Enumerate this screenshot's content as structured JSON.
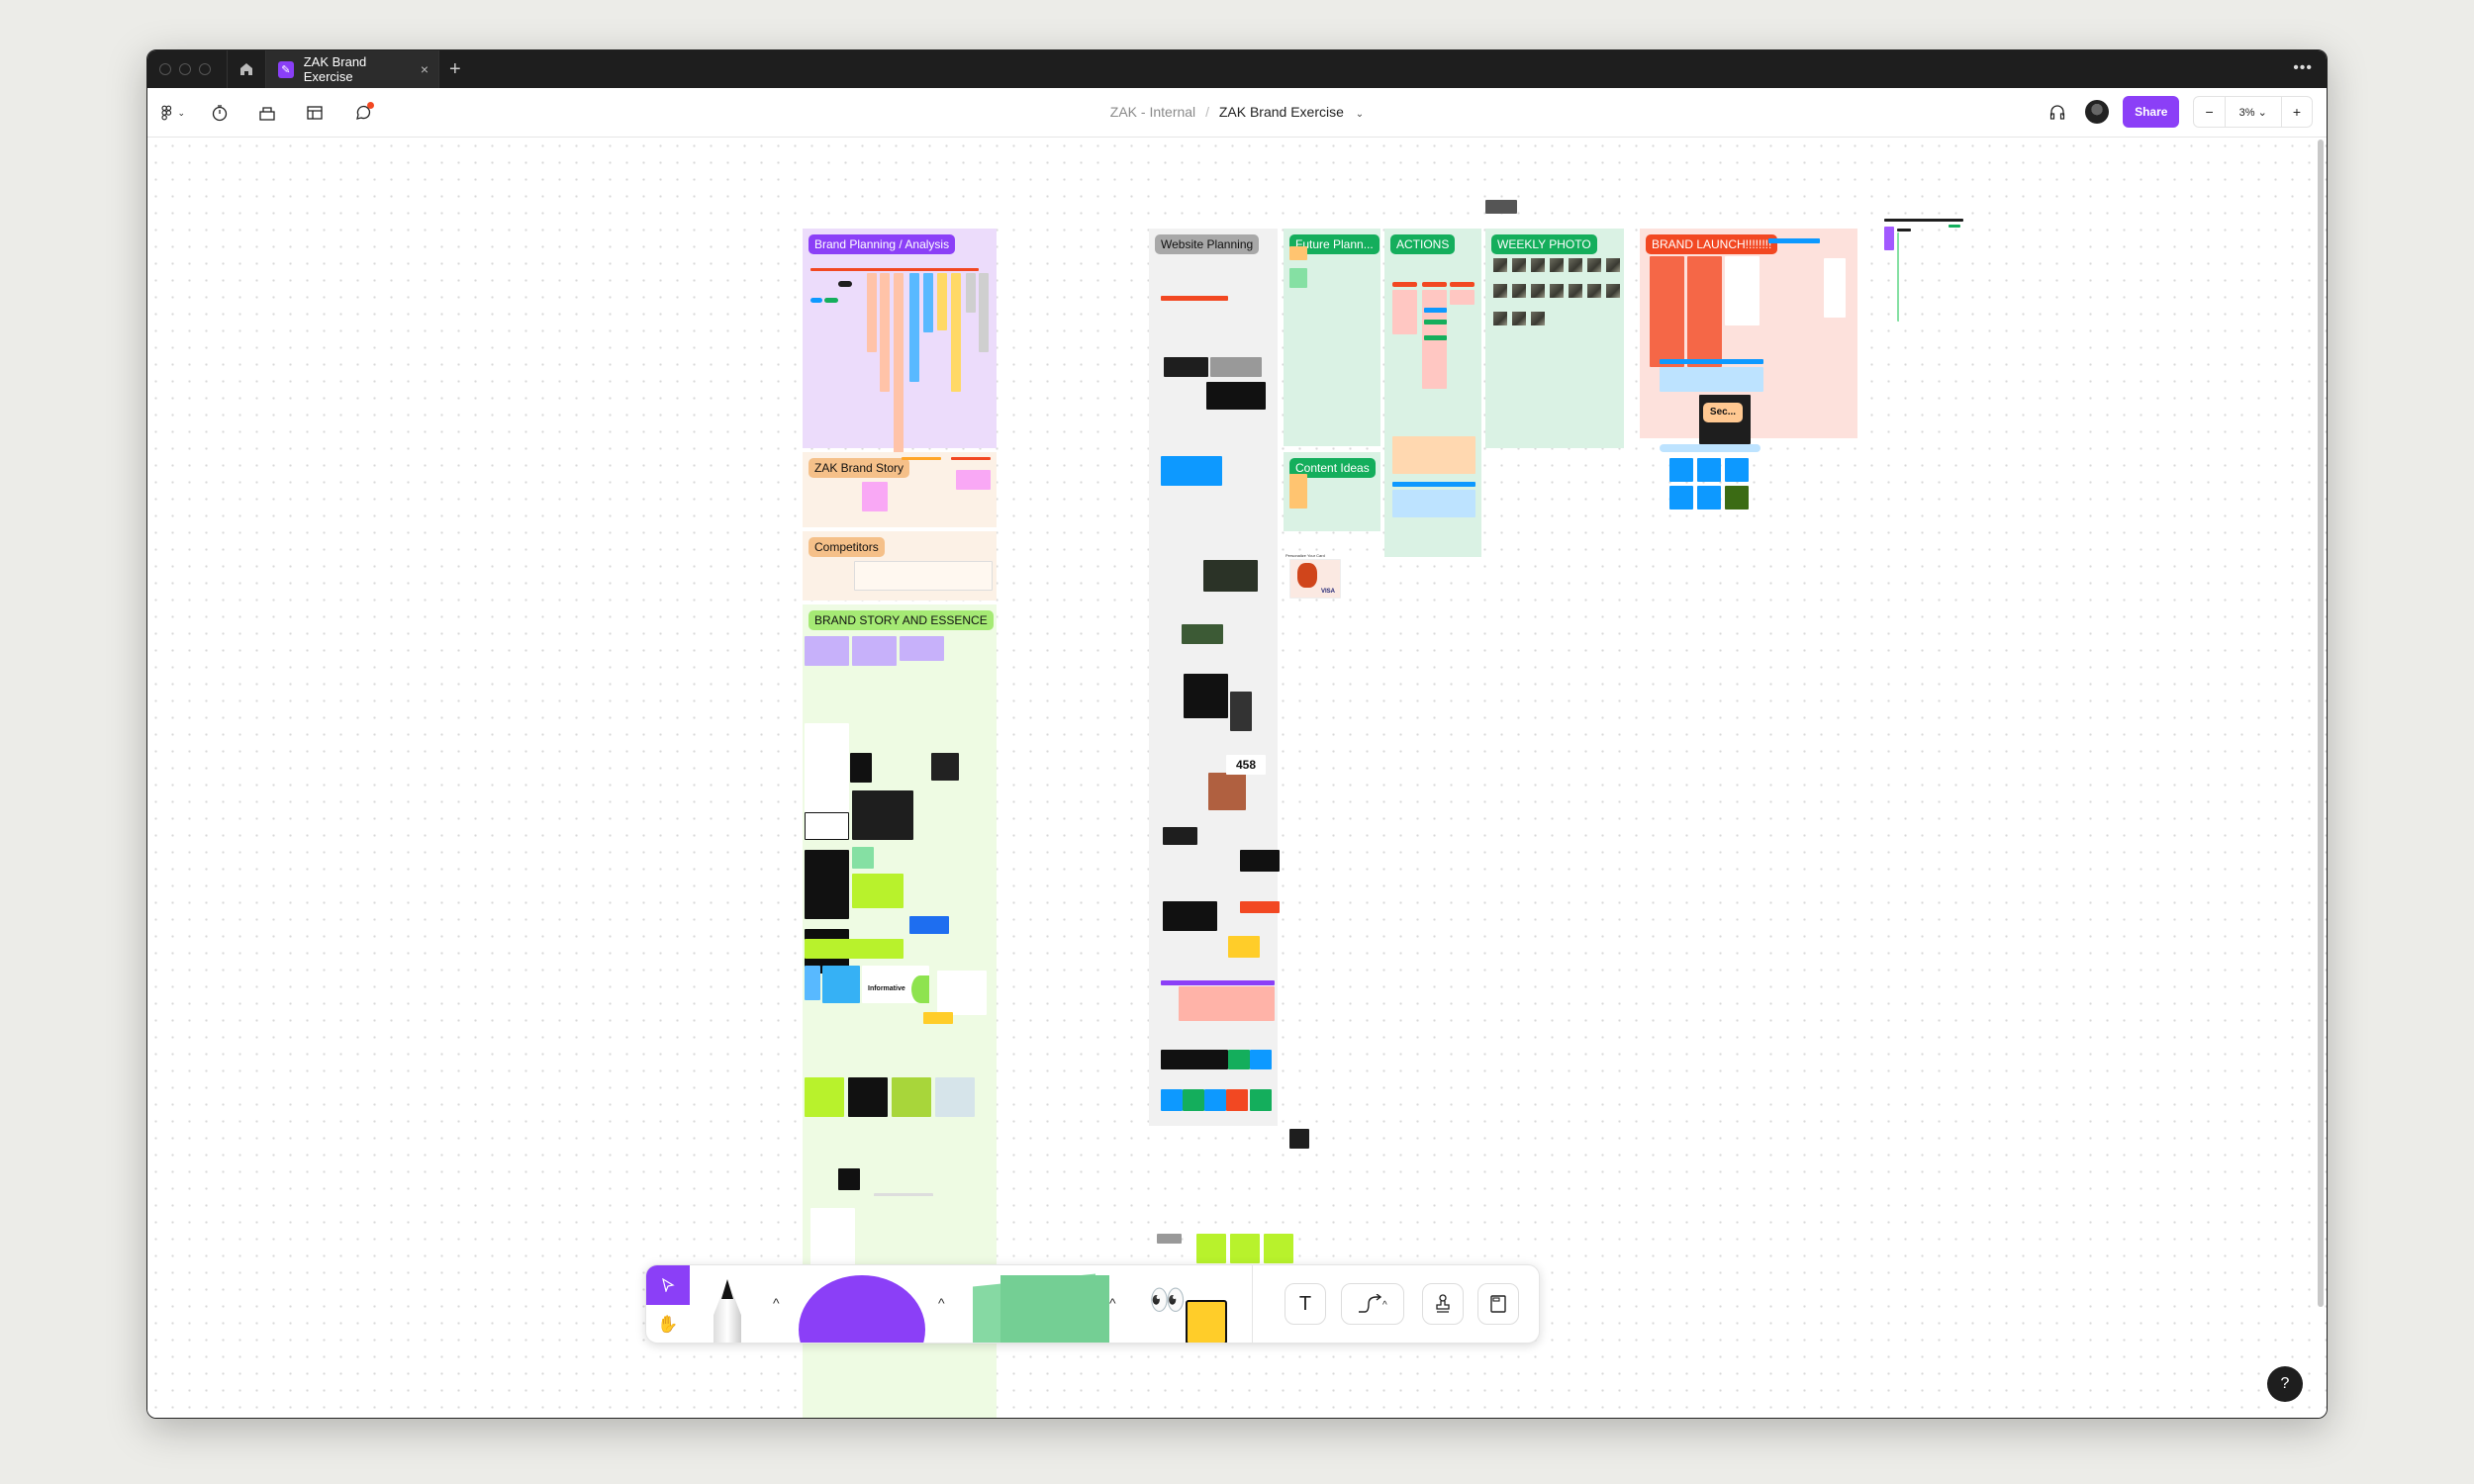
{
  "titlebar": {
    "tab_title": "ZAK Brand Exercise",
    "tab_icon": "figjam-file-icon",
    "close_label": "×",
    "new_tab_label": "+",
    "more_label": "•••"
  },
  "toolbar": {
    "breadcrumb_team": "ZAK - Internal",
    "breadcrumb_sep": "/",
    "file_name": "ZAK Brand Exercise",
    "share_label": "Share",
    "zoom_out_label": "−",
    "zoom_level": "3% ⌄",
    "zoom_in_label": "+",
    "left_tools": [
      "figma-menu-icon",
      "timer-icon",
      "resources-icon",
      "templates-icon",
      "comments-icon"
    ]
  },
  "canvas": {
    "sections": [
      {
        "id": "brand-planning",
        "label": "Brand Planning / Analysis",
        "label_color": "#8b3ff7",
        "bg": "#ecdcfb"
      },
      {
        "id": "website-planning",
        "label": "Website Planning",
        "label_color": "#8a8a8a",
        "bg": "#f1f1f1"
      },
      {
        "id": "future-planning",
        "label": "Future Plann...",
        "label_color": "#14ae5c",
        "bg": "#daf2e4"
      },
      {
        "id": "actions",
        "label": "ACTIONS",
        "label_color": "#14ae5c",
        "bg": "#daf2e4"
      },
      {
        "id": "weekly-photo",
        "label": "WEEKLY PHOTO",
        "label_color": "#14ae5c",
        "bg": "#daf2e4"
      },
      {
        "id": "brand-launch",
        "label": "BRAND LAUNCH!!!!!!!!",
        "label_color": "#f24822",
        "bg": "#fde1dc"
      },
      {
        "id": "zak-brand-story",
        "label": "ZAK Brand Story",
        "label_color": "#f5c089",
        "bg": "#fcf1e6"
      },
      {
        "id": "competitors",
        "label": "Competitors",
        "label_color": "#f5c089",
        "bg": "#fcf1e6"
      },
      {
        "id": "brand-story-essence",
        "label": "BRAND STORY AND ESSENCE",
        "label_color": "#a5ea74",
        "bg": "#eefbe3"
      },
      {
        "id": "content-ideas",
        "label": "Content Ideas",
        "label_color": "#14ae5c",
        "bg": "#daf2e4"
      }
    ],
    "inline_text": {
      "informative": "Informative",
      "counter": "458",
      "sec_label": "Sec...",
      "card_caption": "Personalize Your Card",
      "card_brand": "VISA"
    }
  },
  "dock": {
    "tools": [
      "select-tool",
      "hand-tool",
      "marker-tool",
      "shape-tool",
      "sticky-note-tool",
      "stickers-widgets-tool",
      "text-tool",
      "connector-tool",
      "stamp-tool",
      "section-tool"
    ],
    "text_tool_glyph": "T",
    "help_label": "?"
  }
}
